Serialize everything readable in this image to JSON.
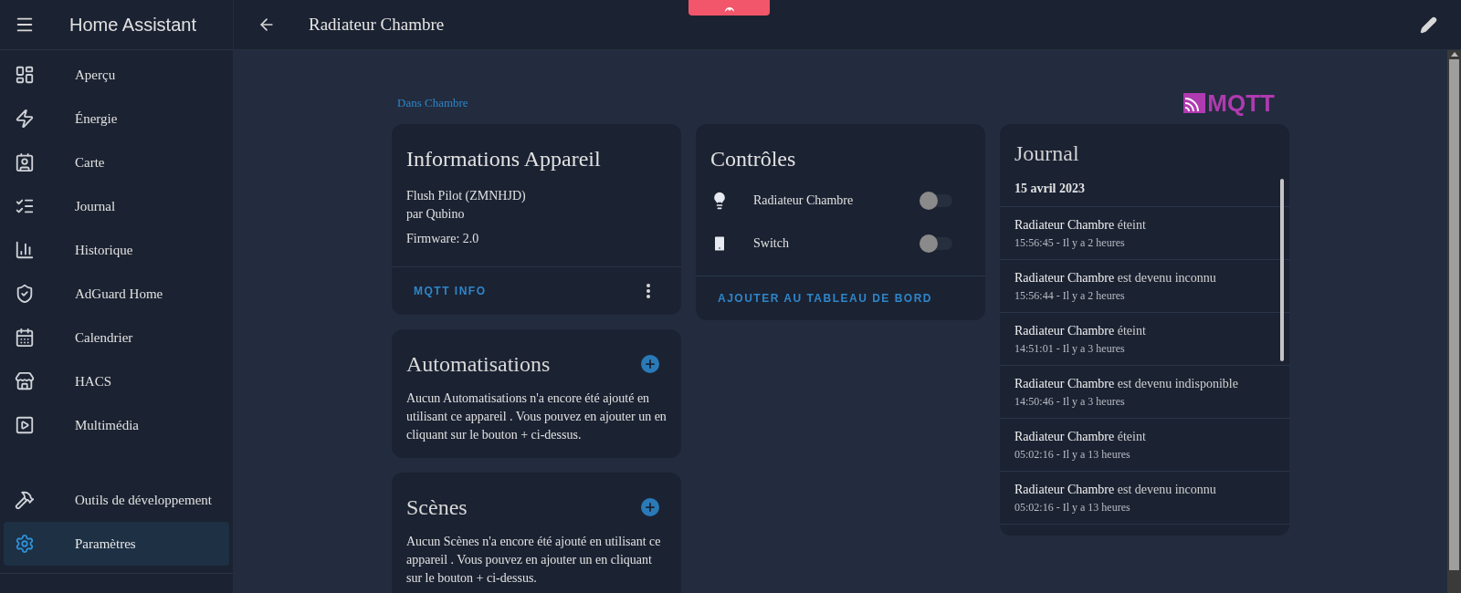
{
  "sidebar": {
    "title": "Home Assistant",
    "items": [
      {
        "label": "Aperçu",
        "selected": false
      },
      {
        "label": "Énergie",
        "selected": false
      },
      {
        "label": "Carte",
        "selected": false
      },
      {
        "label": "Journal",
        "selected": false
      },
      {
        "label": "Historique",
        "selected": false
      },
      {
        "label": "AdGuard Home",
        "selected": false
      },
      {
        "label": "Calendrier",
        "selected": false
      },
      {
        "label": "HACS",
        "selected": false
      },
      {
        "label": "Multimédia",
        "selected": false
      }
    ],
    "bottom_items": [
      {
        "label": "Outils de développement",
        "selected": false
      },
      {
        "label": "Paramètres",
        "selected": true
      }
    ]
  },
  "header": {
    "title": "Radiateur Chambre"
  },
  "area_link": "Dans Chambre",
  "integration_logo": "MQTT",
  "device_info": {
    "title": "Informations Appareil",
    "model": "Flush Pilot (ZMNHJD)",
    "manufacturer": "par Qubino",
    "firmware": "Firmware: 2.0",
    "action": "MQTT INFO"
  },
  "automations": {
    "title": "Automatisations",
    "text": "Aucun Automatisations n'a encore été ajouté en utilisant ce appareil . Vous pouvez en ajouter un en cliquant sur le bouton + ci-dessus."
  },
  "scenes": {
    "title": "Scènes",
    "text": "Aucun Scènes n'a encore été ajouté en utilisant ce appareil . Vous pouvez en ajouter un en cliquant sur le bouton + ci-dessus."
  },
  "controls": {
    "title": "Contrôles",
    "entities": [
      {
        "name": "Radiateur Chambre",
        "on": false
      },
      {
        "name": "Switch",
        "on": false
      }
    ],
    "action": "AJOUTER AU TABLEAU DE BORD"
  },
  "journal": {
    "title": "Journal",
    "date": "15 avril 2023",
    "entries": [
      {
        "entity": "Radiateur Chambre",
        "message": "éteint",
        "time": "15:56:45 - Il y a 2 heures"
      },
      {
        "entity": "Radiateur Chambre",
        "message": "est devenu inconnu",
        "time": "15:56:44 - Il y a 2 heures"
      },
      {
        "entity": "Radiateur Chambre",
        "message": "éteint",
        "time": "14:51:01 - Il y a 3 heures"
      },
      {
        "entity": "Radiateur Chambre",
        "message": "est devenu indisponible",
        "time": "14:50:46 - Il y a 3 heures"
      },
      {
        "entity": "Radiateur Chambre",
        "message": "éteint",
        "time": "05:02:16 - Il y a 13 heures"
      },
      {
        "entity": "Radiateur Chambre",
        "message": "est devenu inconnu",
        "time": "05:02:16 - Il y a 13 heures"
      }
    ]
  }
}
